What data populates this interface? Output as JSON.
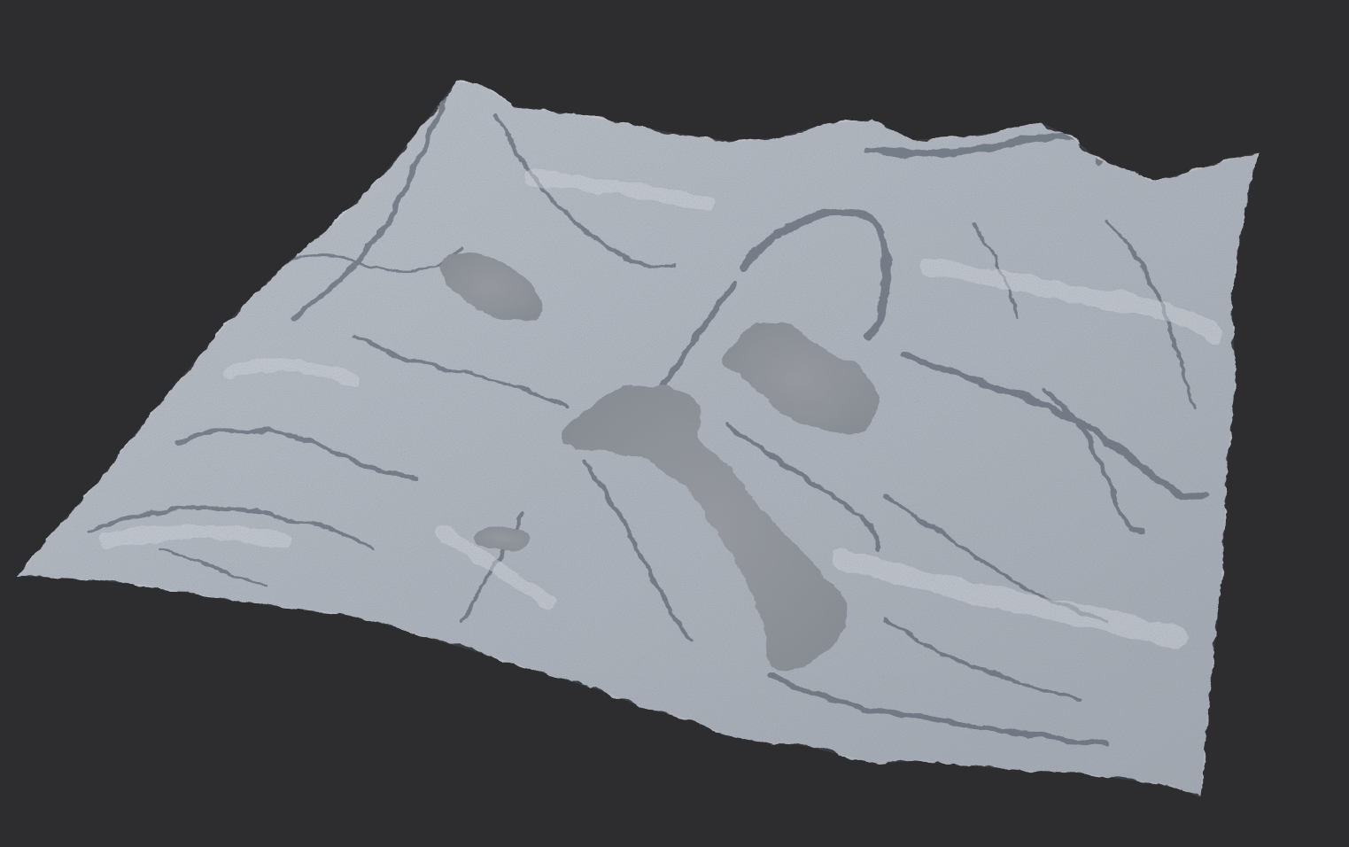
{
  "scene": {
    "background_color": "#2d2d2f",
    "terrain_color": "#b9bec6",
    "terrain_shadow_color": "#3b4250",
    "water_color": "#8e939a",
    "render_style": "untextured clay heightmap terrain, perspective view",
    "lakes_visible": 4
  }
}
